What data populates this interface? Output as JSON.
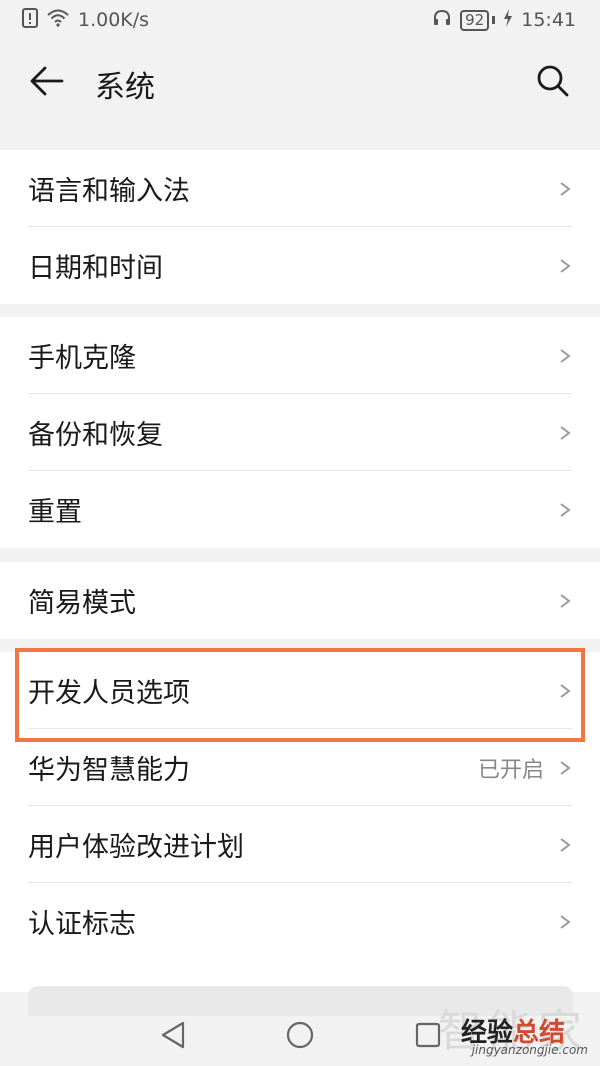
{
  "status_bar": {
    "network_speed": "1.00K/s",
    "battery_percent": "92",
    "time": "15:41"
  },
  "app_bar": {
    "title": "系统",
    "back_icon": "arrow-left-icon",
    "search_icon": "search-icon"
  },
  "sections": [
    {
      "items": [
        {
          "label": "语言和输入法"
        },
        {
          "label": "日期和时间"
        }
      ]
    },
    {
      "items": [
        {
          "label": "手机克隆"
        },
        {
          "label": "备份和恢复"
        },
        {
          "label": "重置"
        }
      ]
    },
    {
      "items": [
        {
          "label": "简易模式"
        }
      ]
    },
    {
      "items": [
        {
          "label": "开发人员选项"
        },
        {
          "label": "华为智慧能力",
          "value": "已开启"
        },
        {
          "label": "用户体验改进计划"
        },
        {
          "label": "认证标志"
        }
      ]
    }
  ],
  "highlight_color": "#f07642",
  "watermark": {
    "top": "智能家",
    "main_part1": "经验",
    "main_part2": "总结",
    "sub": "jingyanzongjie.com"
  }
}
